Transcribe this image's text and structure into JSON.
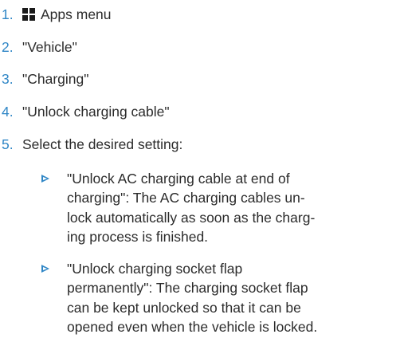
{
  "steps": [
    {
      "number": "1.",
      "text": "Apps menu",
      "icon": "apps-grid-icon"
    },
    {
      "number": "2.",
      "text": "\"Vehicle\""
    },
    {
      "number": "3.",
      "text": "\"Charging\""
    },
    {
      "number": "4.",
      "text": "\"Unlock charging cable\""
    },
    {
      "number": "5.",
      "text": "Select the desired setting:"
    }
  ],
  "options": [
    {
      "lines": [
        "\"Unlock AC charging cable at end of",
        "charging\": The AC charging cables un-",
        "lock automatically as soon as the charg-",
        "ing process is finished."
      ]
    },
    {
      "lines": [
        "\"Unlock charging socket flap",
        "permanently\": The charging socket flap",
        "can be kept unlocked so that it can be",
        "opened even when the vehicle is locked."
      ]
    }
  ],
  "colors": {
    "accent": "#2f86c6",
    "text": "#2b2b2b"
  }
}
